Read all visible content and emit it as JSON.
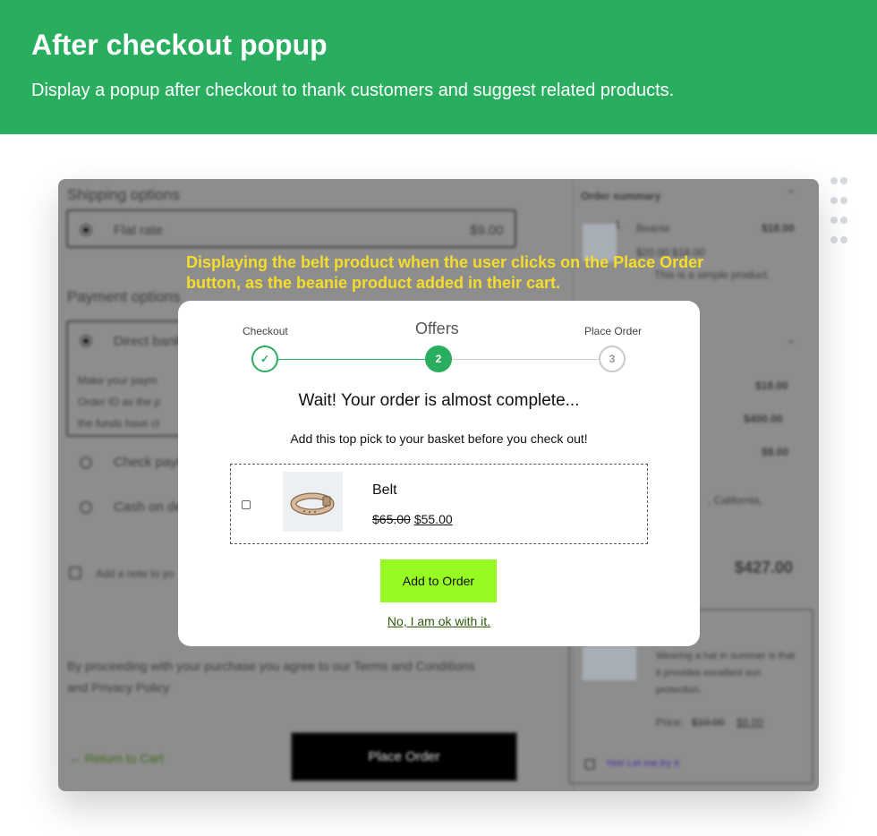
{
  "banner": {
    "title": "After checkout popup",
    "subtitle": "Display a popup after checkout to thank customers and suggest related products."
  },
  "background_page": {
    "shipping_heading": "Shipping options",
    "flat_rate_label": "Flat rate",
    "flat_rate_price": "$9.00",
    "payment_heading": "Payment options",
    "direct_bank_label": "Direct bank",
    "payment_desc_line1": "Make your paym",
    "payment_desc_line2": "Order ID as the p",
    "payment_desc_line3": "the funds have cl",
    "check_label": "Check payme",
    "cash_label": "Cash on de",
    "add_note_label": "Add a note to yo",
    "terms_line1": "By proceeding with your purchase you agree to our Terms and Conditions",
    "terms_line2": "and Privacy Policy",
    "return_link": "← Return to Cart",
    "place_order_button": "Place Order",
    "summary_heading": "Order summary",
    "summary_item_qty": "1",
    "summary_item_name": "Beanie",
    "summary_item_price": "$18.00",
    "summary_item_old": "$20.00 $18.00",
    "summary_item_desc": "This is a simple product.",
    "totals": [
      "$18.00",
      "$400.00",
      "$9.00"
    ],
    "address_fragment": ", California,",
    "grand_total": "$427.00",
    "upsell_desc": "Wearing a hat in summer is that it provides excellent sun protection.",
    "upsell_price_label": "Price:",
    "upsell_price_old": "$10.00",
    "upsell_price_new": "$8.00",
    "upsell_link": "Yes! Let me try it."
  },
  "annotation": "Displaying the belt product when the user clicks on the Place Order button, as the beanie product added in their cart.",
  "popup": {
    "steps": [
      {
        "label": "Checkout",
        "marker": "✓",
        "state": "done"
      },
      {
        "label": "Offers",
        "marker": "2",
        "state": "current"
      },
      {
        "label": "Place Order",
        "marker": "3",
        "state": "pending"
      }
    ],
    "headline": "Wait! Your order is almost complete...",
    "subheadline": "Add this top pick to your basket before you check out!",
    "product": {
      "name": "Belt",
      "old_price": "$65.00",
      "new_price": "$55.00",
      "checked": false
    },
    "add_button": "Add to Order",
    "decline_link": "No, I am ok with it."
  },
  "colors": {
    "brand_green": "#29ae60",
    "cta_lime": "#97fa22",
    "annotation_yellow": "#f5dd2a"
  }
}
